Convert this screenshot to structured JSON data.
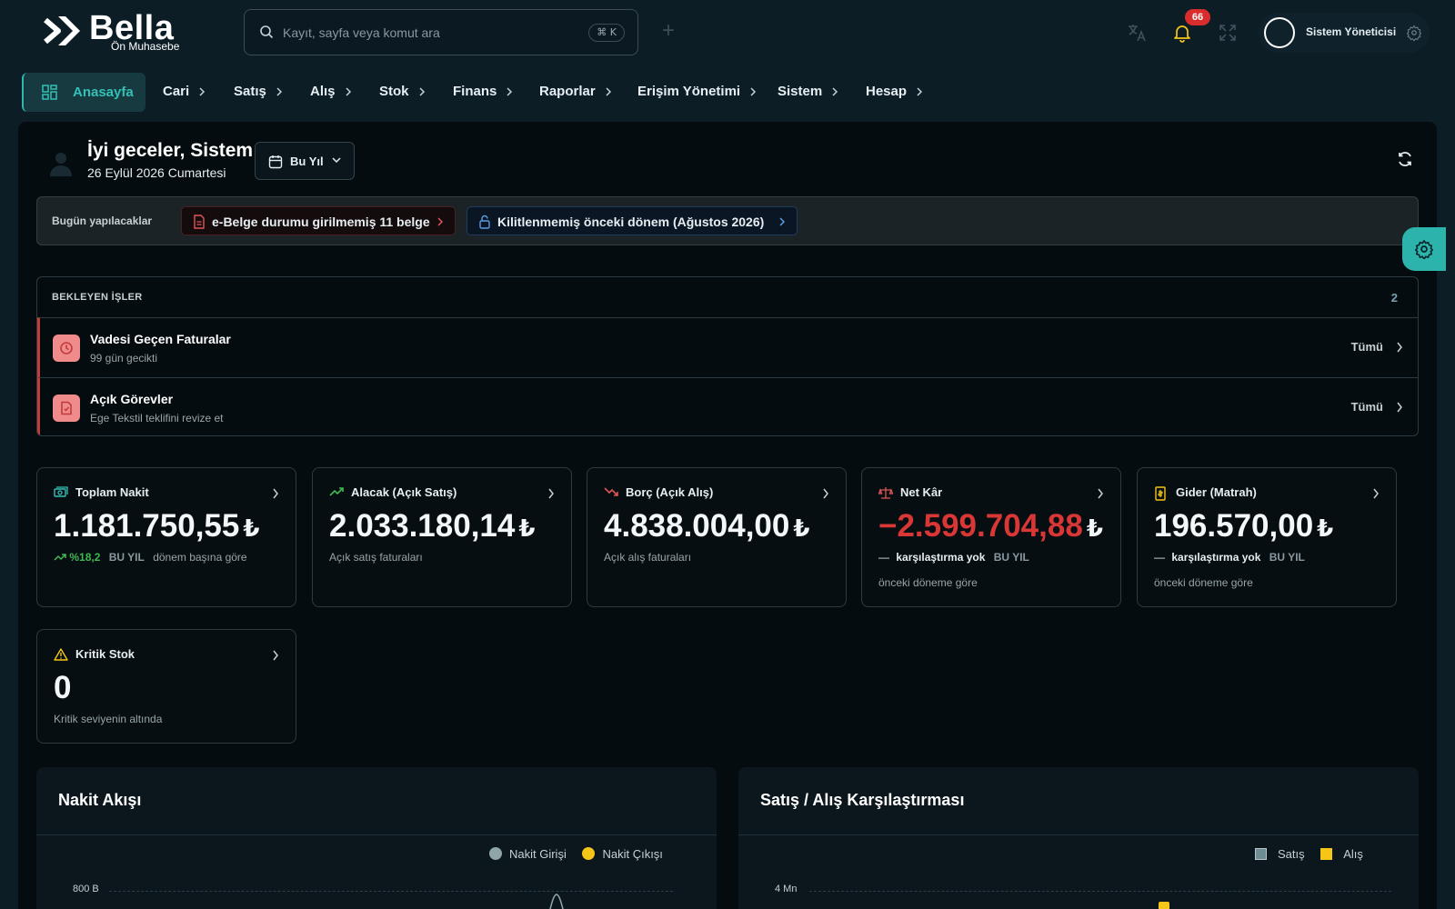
{
  "brand": {
    "name": "Bella",
    "subtitle": "Ön Muhasebe"
  },
  "search": {
    "placeholder": "Kayıt, sayfa veya komut ara",
    "shortcut": "⌘ K"
  },
  "header": {
    "notification_count": "66",
    "user_name": "Sistem Yöneticisi",
    "icons": [
      "translate-icon",
      "bell-icon",
      "fullscreen-icon",
      "gear-icon"
    ]
  },
  "nav": {
    "home": "Anasayfa",
    "items": [
      "Cari",
      "Satış",
      "Alış",
      "Stok",
      "Finans",
      "Raporlar",
      "Erişim Yönetimi",
      "Sistem",
      "Hesap"
    ]
  },
  "greeting": {
    "title": "İyi geceler, Sistem",
    "date": "26 Eylül 2026 Cumartesi",
    "period": "Bu Yıl"
  },
  "todo": {
    "label": "Bugün yapılacaklar",
    "chips": [
      {
        "text": "e-Belge durumu girilmemiş 11 belge",
        "color": "#e05555"
      },
      {
        "text": "Kilitlenmemiş önceki dönem (Ağustos 2026)",
        "color": "#5b9be0"
      }
    ]
  },
  "pending": {
    "title": "BEKLEYEN İŞLER",
    "count": "2",
    "items": [
      {
        "title": "Vadesi Geçen Faturalar",
        "subtitle": "99 gün gecikti",
        "action": "Tümü"
      },
      {
        "title": "Açık Görevler",
        "subtitle": "Ege Tekstil teklifini revize et",
        "action": "Tümü"
      }
    ]
  },
  "kpis": [
    {
      "title": "Toplam Nakit",
      "value": "1.181.750,55",
      "currency": "₺",
      "delta": "%18,2",
      "period": "BU YIL",
      "note": "dönem başına göre"
    },
    {
      "title": "Alacak (Açık Satış)",
      "value": "2.033.180,14",
      "currency": "₺",
      "note": "Açık satış faturaları"
    },
    {
      "title": "Borç (Açık Alış)",
      "value": "4.838.004,00",
      "currency": "₺",
      "note": "Açık alış faturaları"
    },
    {
      "title": "Net Kâr",
      "value": "−2.599.704,88",
      "currency": "₺",
      "delta": "karşılaştırma yok",
      "period": "BU YIL",
      "note": "önceki döneme göre"
    },
    {
      "title": "Gider (Matrah)",
      "value": "196.570,00",
      "currency": "₺",
      "delta": "karşılaştırma yok",
      "period": "BU YIL",
      "note": "önceki döneme göre"
    },
    {
      "title": "Kritik Stok",
      "value": "0",
      "note": "Kritik seviyenin altında"
    }
  ],
  "charts": {
    "cashflow": {
      "title": "Nakit Akışı",
      "legend": [
        {
          "name": "Nakit Girişi",
          "color": "#8fa5a8"
        },
        {
          "name": "Nakit Çıkışı",
          "color": "#f5c518"
        }
      ],
      "y_tick": "800 B"
    },
    "salespurchase": {
      "title": "Satış / Alış Karşılaştırması",
      "legend": [
        {
          "name": "Satış",
          "color": "#6e8c93"
        },
        {
          "name": "Alış",
          "color": "#f5c518"
        }
      ],
      "y_tick": "4 Mn"
    }
  }
}
